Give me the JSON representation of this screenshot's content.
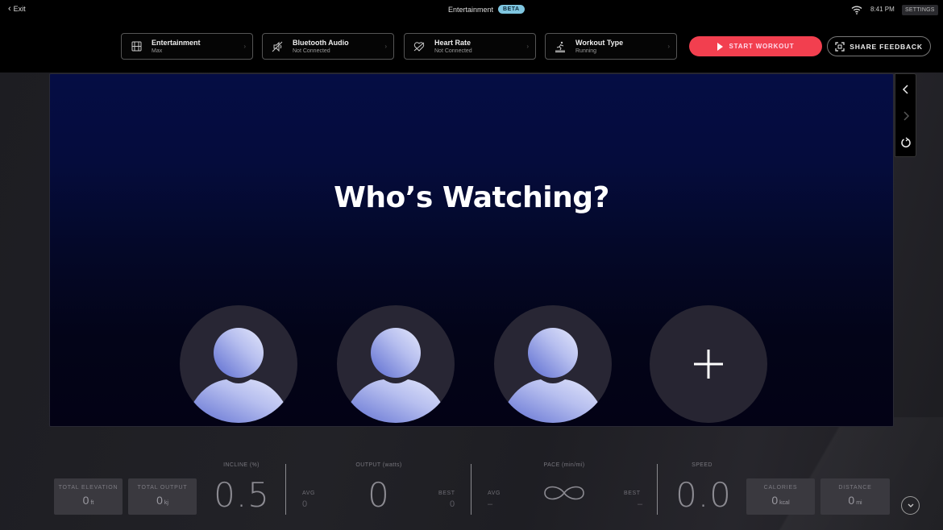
{
  "status_bar": {
    "exit_label": "Exit",
    "app_title": "Entertainment",
    "beta_badge": "BETA",
    "time": "8:41 PM",
    "settings_label": "SETTINGS",
    "wifi_icon": "wifi-icon"
  },
  "toolbar": {
    "tiles": [
      {
        "title": "Entertainment",
        "subtitle": "Max",
        "icon": "film-icon"
      },
      {
        "title": "Bluetooth Audio",
        "subtitle": "Not Connected",
        "icon": "bluetooth-audio-off-icon"
      },
      {
        "title": "Heart Rate",
        "subtitle": "Not Connected",
        "icon": "heart-rate-off-icon"
      },
      {
        "title": "Workout Type",
        "subtitle": "Running",
        "icon": "treadmill-icon"
      }
    ],
    "start_workout": "START WORKOUT",
    "share_feedback": "SHARE FEEDBACK"
  },
  "viewport": {
    "heading": "Who’s Watching?",
    "profiles": [
      {
        "name": "profile-1"
      },
      {
        "name": "profile-2"
      },
      {
        "name": "profile-3"
      }
    ],
    "add_profile_icon": "plus-icon"
  },
  "side_nav": {
    "back_icon": "chevron-left-icon",
    "forward_icon": "chevron-right-icon",
    "reload_icon": "reload-icon"
  },
  "metrics": {
    "total_elevation": {
      "label": "TOTAL ELEVATION",
      "value": "0",
      "unit": "ft"
    },
    "total_output": {
      "label": "TOTAL OUTPUT",
      "value": "0",
      "unit": "kj"
    },
    "incline": {
      "label": "INCLINE (%)",
      "value": "0.5"
    },
    "output": {
      "label": "OUTPUT (watts)",
      "value": "0",
      "avg_label": "AVG",
      "avg_value": "0",
      "best_label": "BEST",
      "best_value": "0"
    },
    "pace": {
      "label": "PACE (min/mi)",
      "value": "∞",
      "avg_label": "AVG",
      "avg_value": "–",
      "best_label": "BEST",
      "best_value": "–"
    },
    "speed": {
      "label": "SPEED",
      "value": "0.0"
    },
    "calories": {
      "label": "CALORIES",
      "value": "0",
      "unit": "kcal"
    },
    "distance": {
      "label": "DISTANCE",
      "value": "0",
      "unit": "mi"
    }
  },
  "colors": {
    "accent_red": "#f23f4f",
    "beta_badge": "#7fc6e0",
    "viewport_navy": "#050d44"
  }
}
